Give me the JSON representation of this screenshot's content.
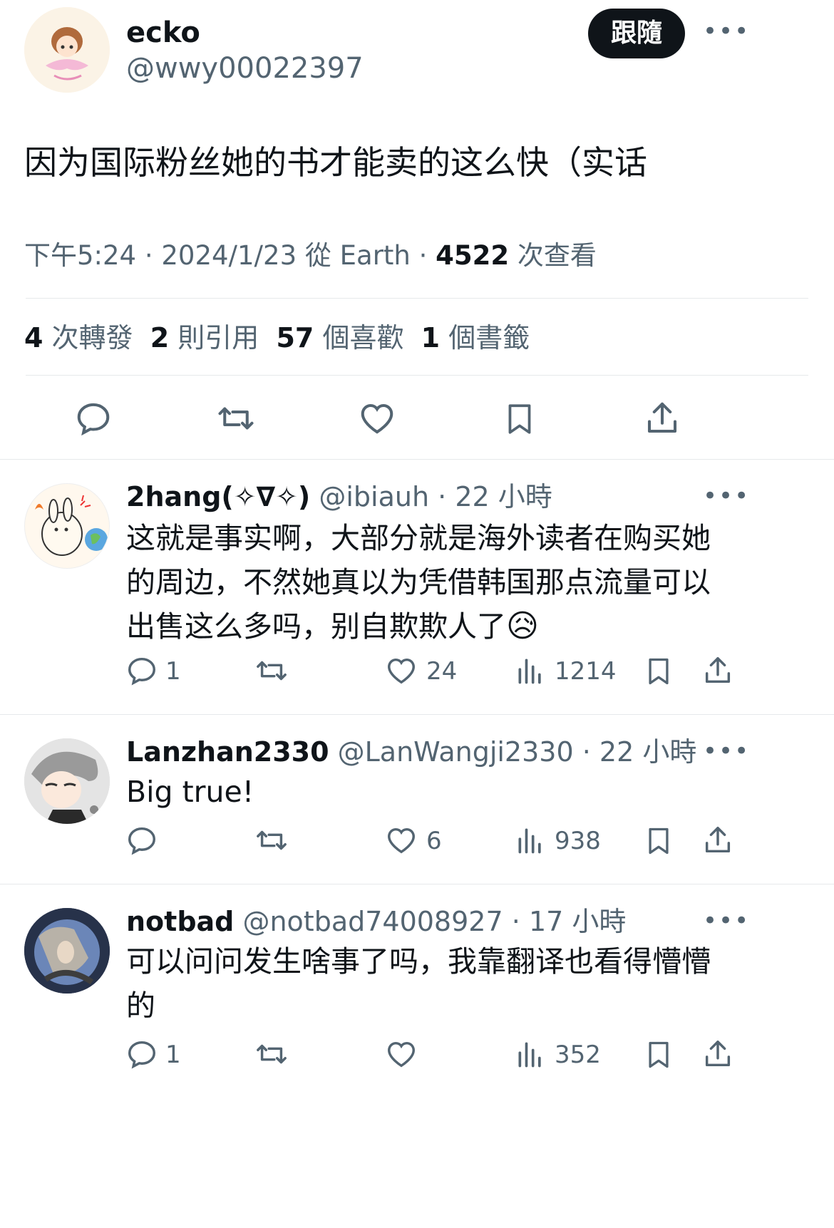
{
  "main_tweet": {
    "display_name": "ecko",
    "handle": "@wwy00022397",
    "follow_label": "跟隨",
    "text": "因为国际粉丝她的书才能卖的这么快（实话",
    "time": "下午5:24",
    "date": "2024/1/23",
    "source_prefix": "從",
    "source": "Earth",
    "views_count": "4522",
    "views_label": "次查看",
    "stats": [
      {
        "num": "4",
        "label": "次轉發"
      },
      {
        "num": "2",
        "label": "則引用"
      },
      {
        "num": "57",
        "label": "個喜歡"
      },
      {
        "num": "1",
        "label": "個書籤"
      }
    ]
  },
  "replies": [
    {
      "display_name": "2hang(✧∇✧)",
      "handle": "@ibiauh",
      "age": "22 小時",
      "lines": [
        "这就是事实啊，大部分就是海外读者在购买她",
        "的周边，不然她真以为凭借韩国那点流量可以",
        "出售这么多吗，别自欺欺人了"
      ],
      "emoji": "😥",
      "reply_count": "1",
      "like_count": "24",
      "views": "1214"
    },
    {
      "display_name": "Lanzhan2330",
      "handle": "@LanWangji2330",
      "age": "22 小時",
      "lines": [
        "Big true!"
      ],
      "reply_count": "",
      "like_count": "6",
      "views": "938"
    },
    {
      "display_name": "notbad",
      "handle": "@notbad74008927",
      "age": "17 小時",
      "lines": [
        "可以问问发生啥事了吗，我靠翻译也看得懵懵",
        "的"
      ],
      "reply_count": "1",
      "like_count": "",
      "views": "352"
    }
  ],
  "icons": [
    "reply-icon",
    "retweet-icon",
    "like-icon",
    "bookmark-icon",
    "share-icon",
    "views-icon",
    "more-icon"
  ],
  "colors": {
    "text": "#0f1419",
    "secondary": "#536471",
    "divider": "#e6e9eb",
    "button": "#0f1419"
  }
}
